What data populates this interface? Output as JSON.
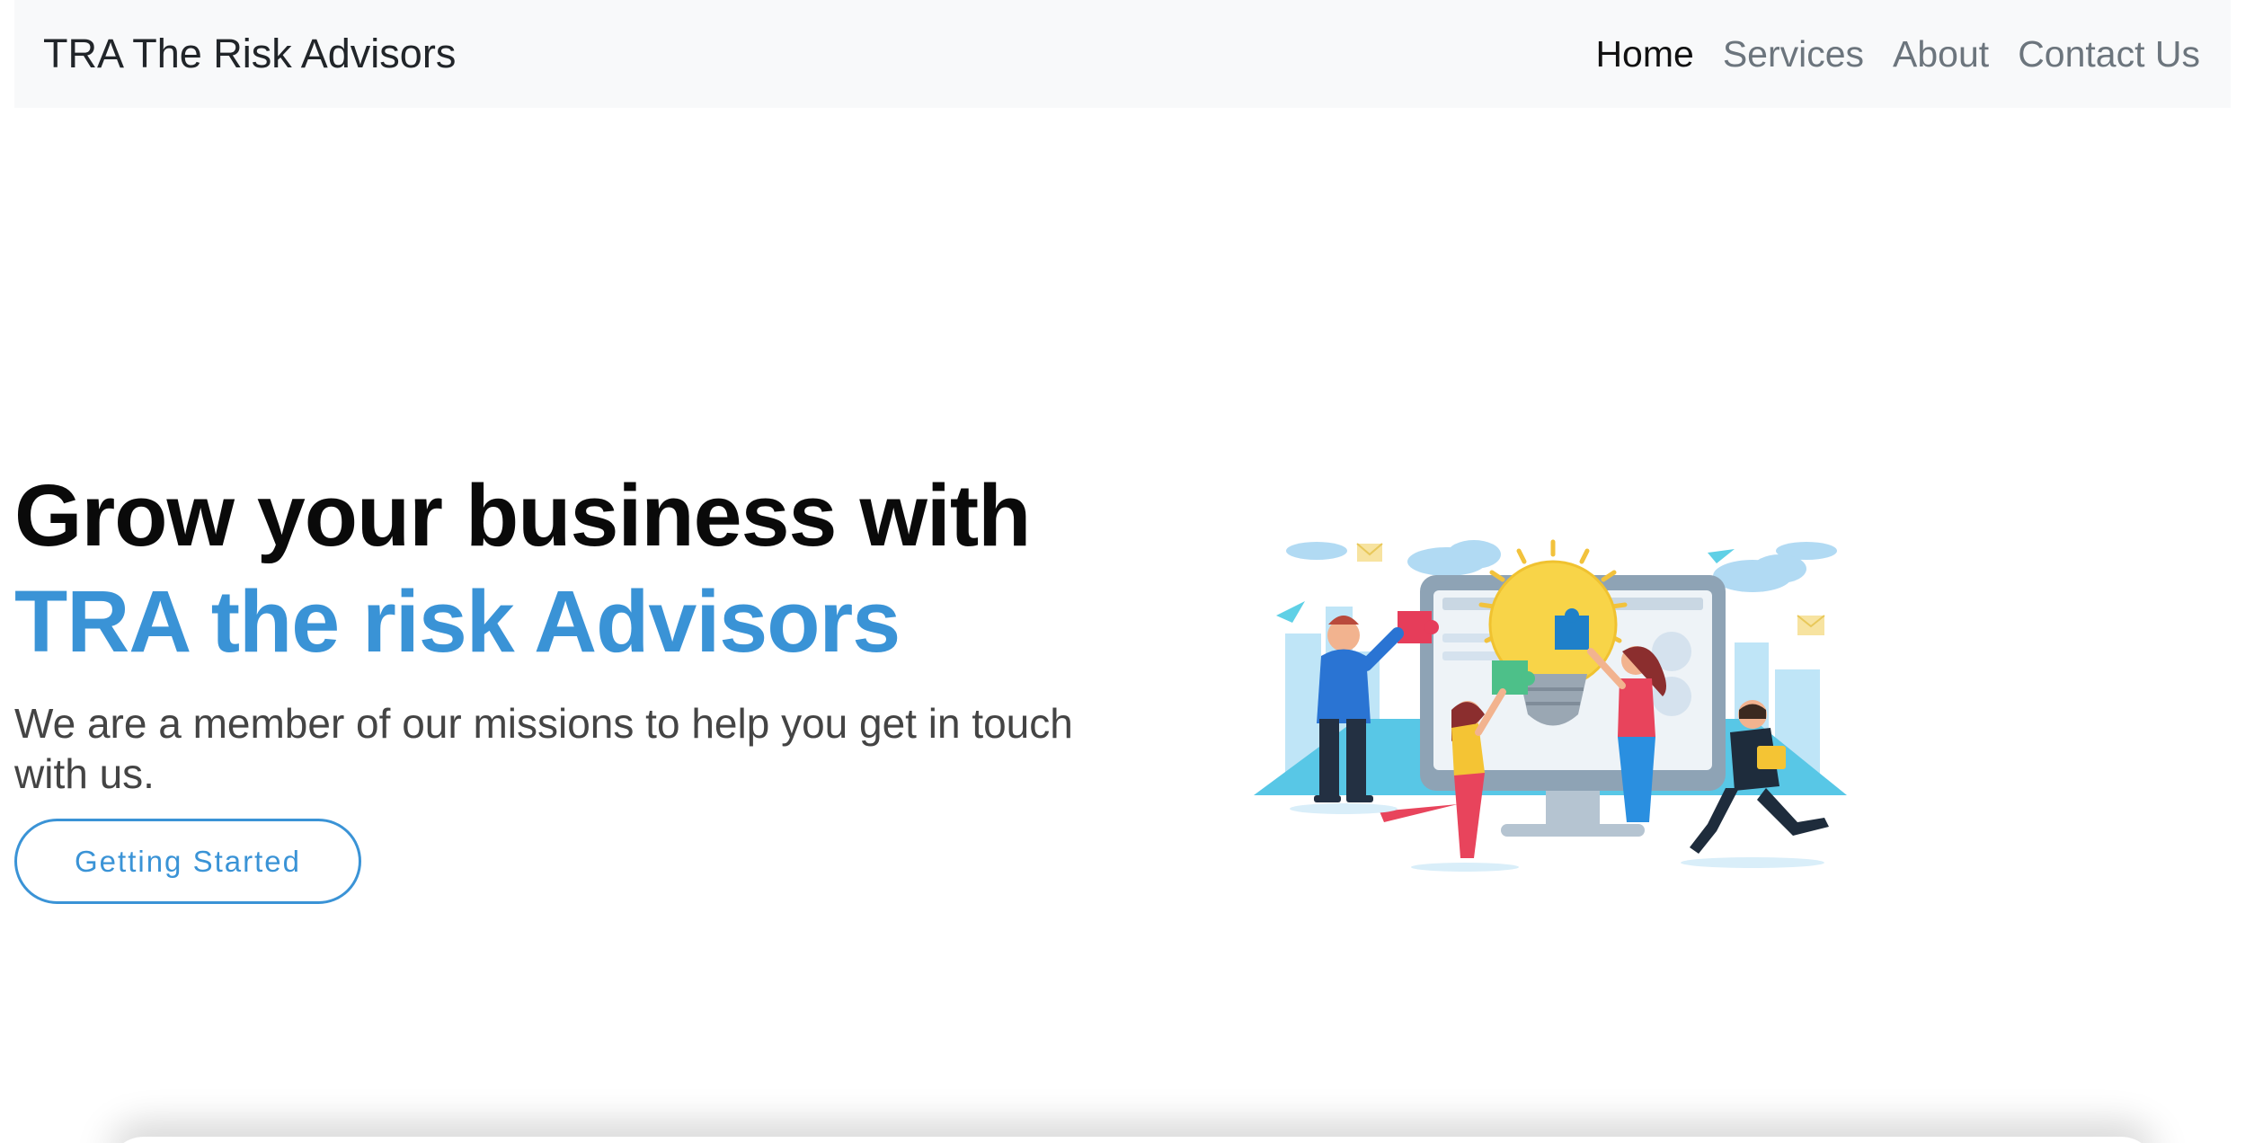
{
  "navbar": {
    "brand": "TRA The Risk Advisors",
    "links": [
      {
        "label": "Home",
        "active": true
      },
      {
        "label": "Services",
        "active": false
      },
      {
        "label": "About",
        "active": false
      },
      {
        "label": "Contact Us",
        "active": false
      }
    ]
  },
  "hero": {
    "headline_line1": "Grow your business with",
    "headline_line2": "TRA the risk Advisors",
    "subtitle": "We are a member of our missions to help you get in touch with us.",
    "cta_label": "Getting Started"
  },
  "colors": {
    "accent": "#3a93d6",
    "navbar_bg": "#f8f9fa",
    "headline": "#0a0a0a",
    "subtitle": "#444444"
  },
  "illustration": {
    "icon": "teamwork-lightbulb-illustration"
  }
}
